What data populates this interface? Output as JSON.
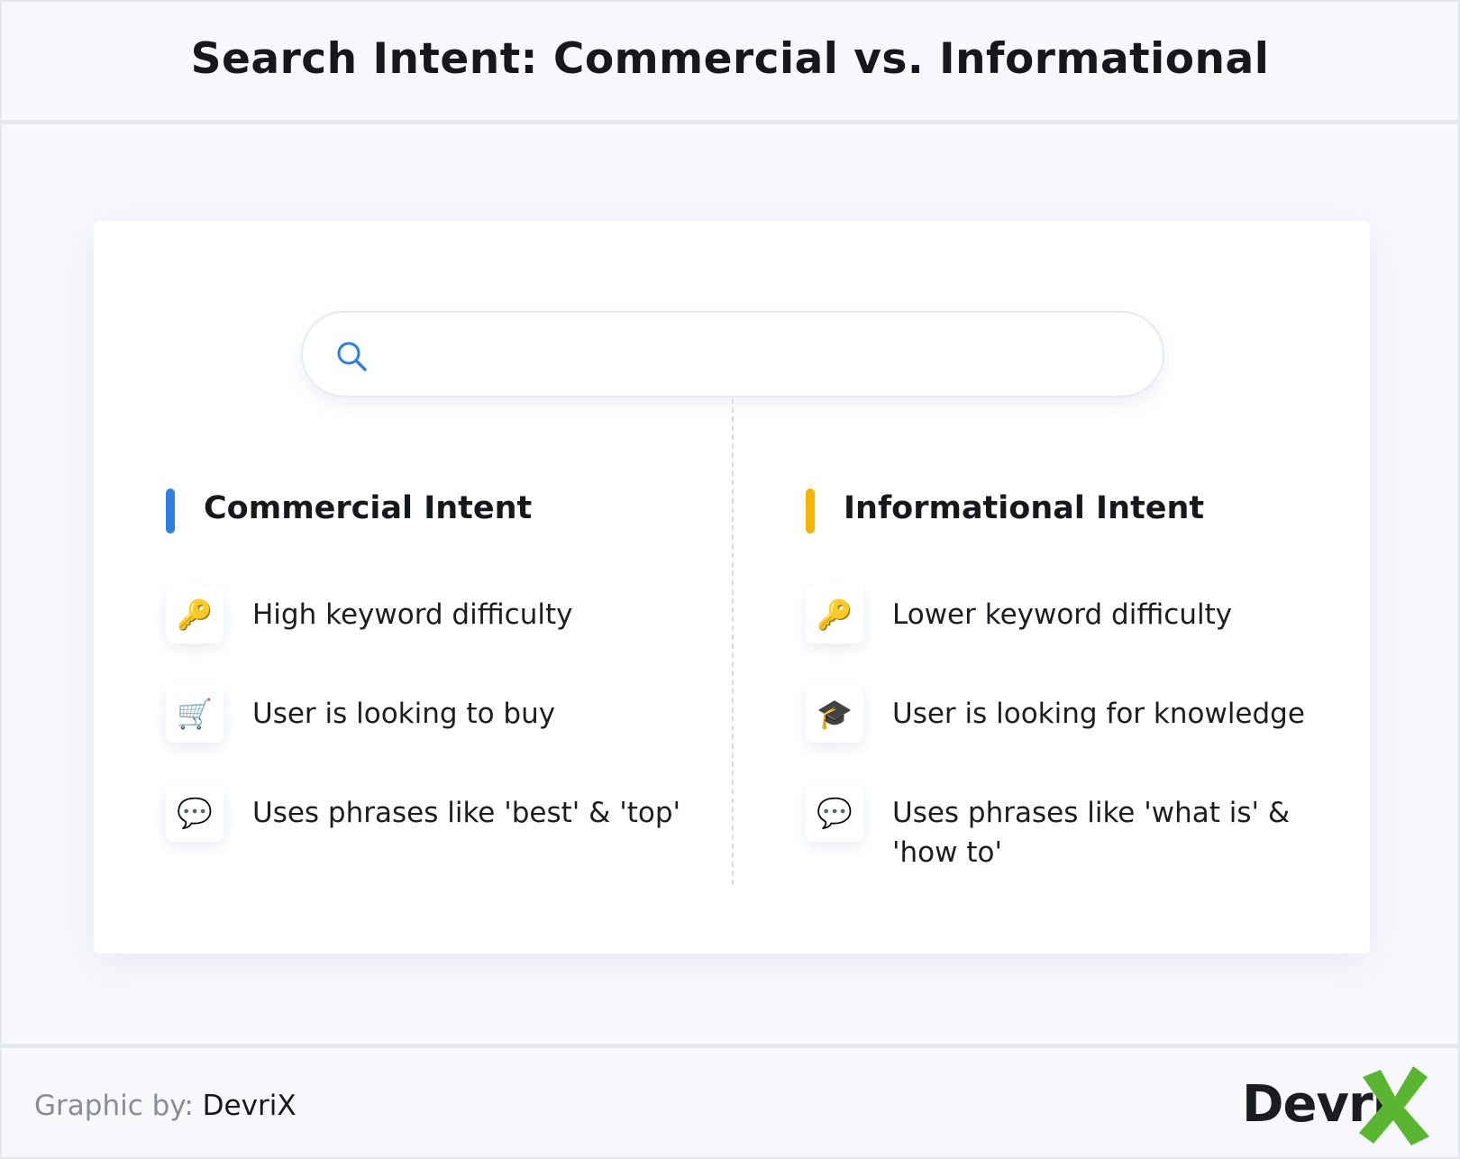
{
  "title": "Search Intent: Commercial vs. Informational",
  "columns": [
    {
      "heading": "Commercial Intent",
      "accent_color": "#2f7ee3",
      "items": [
        {
          "icon": "key-icon",
          "glyph": "🔑",
          "text": "High keyword difficulty"
        },
        {
          "icon": "shopping-cart-icon",
          "glyph": "🛒",
          "text": "User is looking to buy"
        },
        {
          "icon": "speech-bubble-icon",
          "glyph": "💬",
          "text": "Uses phrases like 'best' & 'top'"
        }
      ]
    },
    {
      "heading": "Informational Intent",
      "accent_color": "#f4b400",
      "items": [
        {
          "icon": "key-icon",
          "glyph": "🔑",
          "text": "Lower keyword difficulty"
        },
        {
          "icon": "graduation-cap-icon",
          "glyph": "🎓",
          "text": "User is looking for knowledge"
        },
        {
          "icon": "speech-bubble-icon",
          "glyph": "💬",
          "text": "Uses phrases like 'what is' & 'how to'"
        }
      ]
    }
  ],
  "footer": {
    "credit_label": "Graphic by:",
    "credit_brand": "DevriX",
    "logo_text": "Devri",
    "logo_accent_color": "#5ab531"
  }
}
